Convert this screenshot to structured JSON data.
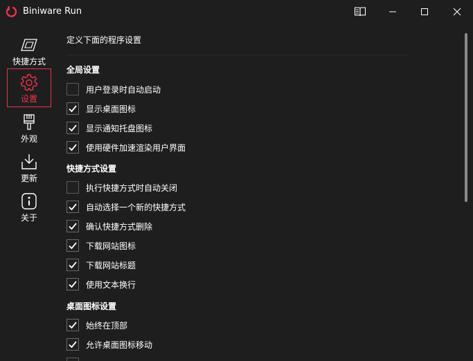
{
  "window": {
    "title": "Biniware Run",
    "controls": {
      "book_icon": "book-icon",
      "minimize_icon": "minimize-icon",
      "maximize_icon": "maximize-icon",
      "close_icon": "close-icon"
    }
  },
  "colors": {
    "accent": "#e8344b",
    "background": "#1e1e1e",
    "text": "#ffffff"
  },
  "sidebar": {
    "items": [
      {
        "label": "快捷方式",
        "icon": "shortcut-icon",
        "active": false
      },
      {
        "label": "设置",
        "icon": "gear-icon",
        "active": true
      },
      {
        "label": "外观",
        "icon": "brush-icon",
        "active": false
      },
      {
        "label": "更新",
        "icon": "download-icon",
        "active": false
      },
      {
        "label": "关于",
        "icon": "info-icon",
        "active": false
      }
    ]
  },
  "main": {
    "header": "定义下面的程序设置",
    "sections": [
      {
        "title": "全局设置",
        "options": [
          {
            "label": "用户登录时自动启动",
            "checked": false
          },
          {
            "label": "显示桌面图标",
            "checked": true
          },
          {
            "label": "显示通知托盘图标",
            "checked": true
          },
          {
            "label": "使用硬件加速渲染用户界面",
            "checked": true
          }
        ]
      },
      {
        "title": "快捷方式设置",
        "options": [
          {
            "label": "执行快捷方式时自动关闭",
            "checked": false
          },
          {
            "label": "自动选择一个新的快捷方式",
            "checked": true
          },
          {
            "label": "确认快捷方式删除",
            "checked": true
          },
          {
            "label": "下载网站图标",
            "checked": true
          },
          {
            "label": "下载网站标题",
            "checked": true
          },
          {
            "label": "使用文本换行",
            "checked": true
          }
        ]
      },
      {
        "title": "桌面图标设置",
        "options": [
          {
            "label": "始终在顶部",
            "checked": true
          },
          {
            "label": "允许桌面图标移动",
            "checked": true
          },
          {
            "label": "",
            "checked": false
          }
        ]
      }
    ]
  }
}
